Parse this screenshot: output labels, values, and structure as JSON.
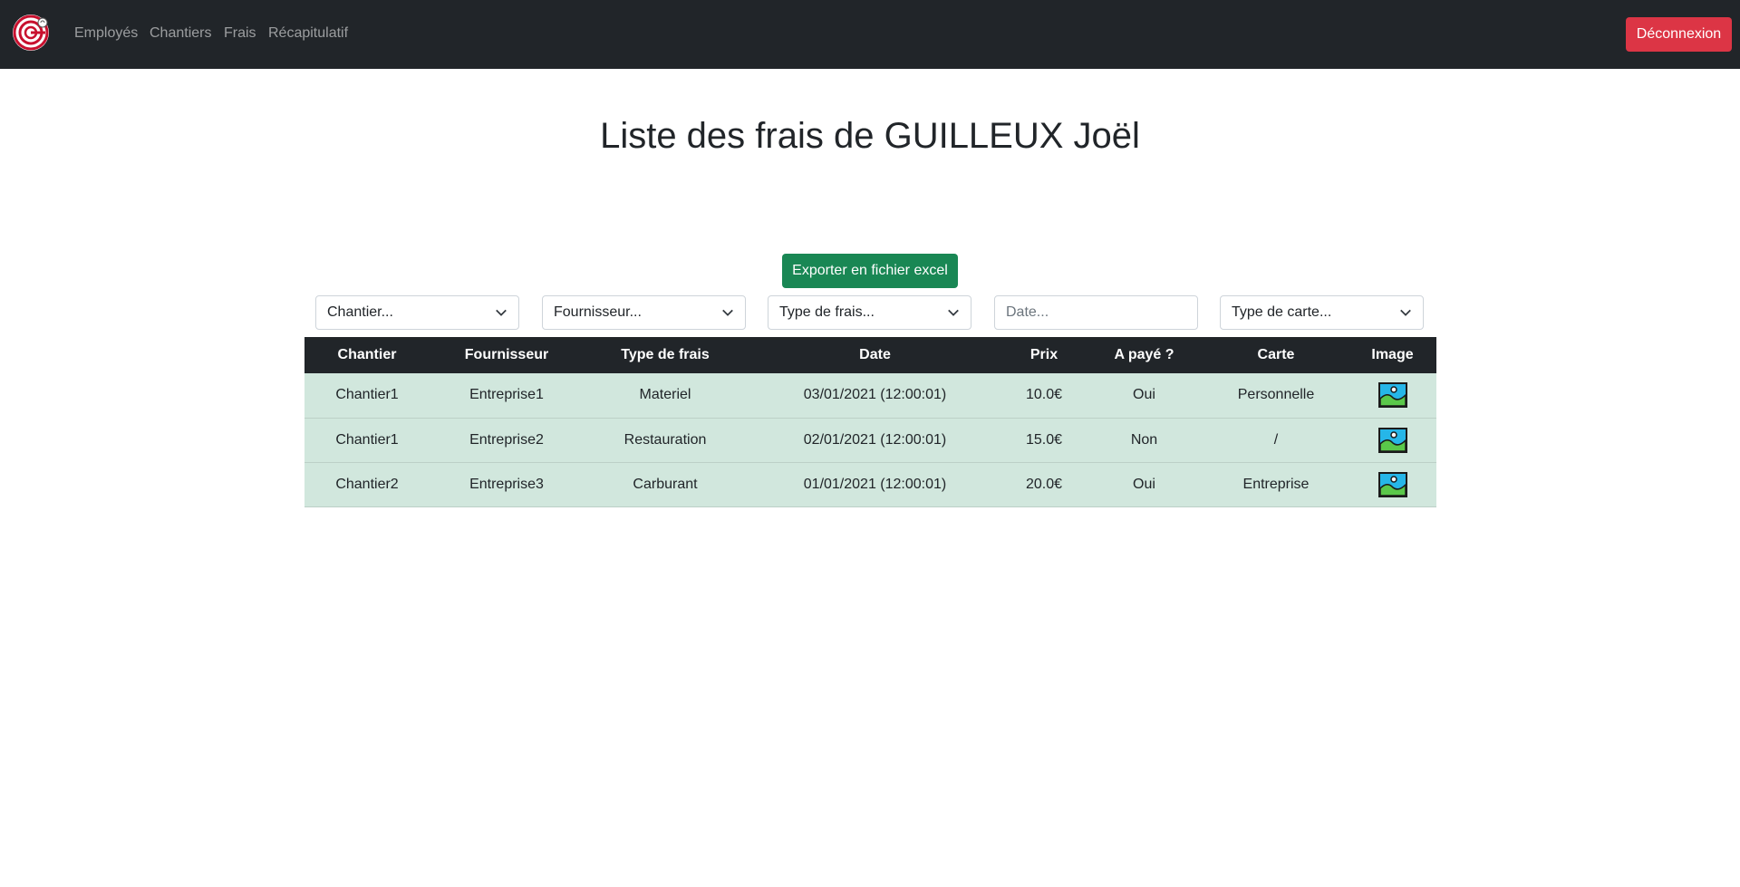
{
  "nav": {
    "links": [
      "Employés",
      "Chantiers",
      "Frais",
      "Récapitulatif"
    ],
    "logout_label": "Déconnexion"
  },
  "page": {
    "title": "Liste des frais de GUILLEUX Joël"
  },
  "export_label": "Exporter en fichier excel",
  "filters": {
    "chantier": "Chantier...",
    "fournisseur": "Fournisseur...",
    "type_frais": "Type de frais...",
    "date_placeholder": "Date...",
    "type_carte": "Type de carte..."
  },
  "table": {
    "headers": [
      "Chantier",
      "Fournisseur",
      "Type de frais",
      "Date",
      "Prix",
      "A payé ?",
      "Carte",
      "Image"
    ],
    "rows": [
      [
        "Chantier1",
        "Entreprise1",
        "Materiel",
        "03/01/2021 (12:00:01)",
        "10.0€",
        "Oui",
        "Personnelle"
      ],
      [
        "Chantier1",
        "Entreprise2",
        "Restauration",
        "02/01/2021 (12:00:01)",
        "15.0€",
        "Non",
        "/"
      ],
      [
        "Chantier2",
        "Entreprise3",
        "Carburant",
        "01/01/2021 (12:00:01)",
        "20.0€",
        "Oui",
        "Entreprise"
      ]
    ]
  },
  "colors": {
    "navbar": "#212529",
    "danger": "#dc3545",
    "success": "#198754",
    "row_bg": "#d1e7dd"
  }
}
